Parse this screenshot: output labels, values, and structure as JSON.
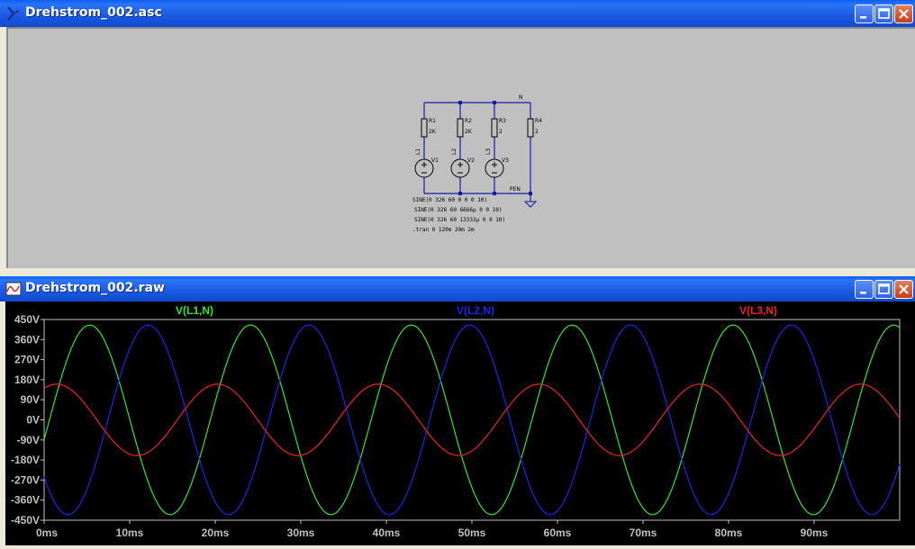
{
  "schematic_window": {
    "title": "Drehstrom_002.asc"
  },
  "schematic": {
    "components": [
      {
        "ref": "R1",
        "value": "2K"
      },
      {
        "ref": "R2",
        "value": "2K"
      },
      {
        "ref": "R3",
        "value": "2"
      },
      {
        "ref": "R4",
        "value": "2"
      },
      {
        "ref": "V1",
        "net": "L1"
      },
      {
        "ref": "V2",
        "net": "L2"
      },
      {
        "ref": "V3",
        "net": "L3"
      }
    ],
    "net_n": "N",
    "net_pen": "PEN",
    "directives": [
      "SINE(0 326 60 0 0 0 10)",
      "SINE(0 326 60 6666µ 0 0 10)",
      "SINE(0 326 60 13333µ 0 0 10)",
      ".tran 0 120m 20m 2m"
    ]
  },
  "waveform_window": {
    "title": "Drehstrom_002.raw"
  },
  "chart_data": {
    "type": "line",
    "xlabel": "",
    "ylabel": "",
    "y_ticks": [
      "450V",
      "360V",
      "270V",
      "180V",
      "90V",
      "0V",
      "-90V",
      "-180V",
      "-270V",
      "-360V",
      "-450V"
    ],
    "x_ticks": [
      "0ms",
      "10ms",
      "20ms",
      "30ms",
      "40ms",
      "50ms",
      "60ms",
      "70ms",
      "80ms",
      "90ms"
    ],
    "ylim": [
      -450,
      450
    ],
    "xlim_ms": [
      0,
      100
    ],
    "grid": false,
    "series": [
      {
        "name": "V(L1,N)",
        "color": "#32e632",
        "amplitude": 425,
        "freq_hz": 53.2,
        "phase_deg": -12
      },
      {
        "name": "V(L2,N)",
        "color": "#2222ee",
        "amplitude": 425,
        "freq_hz": 53.2,
        "phase_deg": -143
      },
      {
        "name": "V(L3,N)",
        "color": "#ee2222",
        "amplitude": 160,
        "freq_hz": 53.2,
        "phase_deg": 62
      }
    ]
  }
}
